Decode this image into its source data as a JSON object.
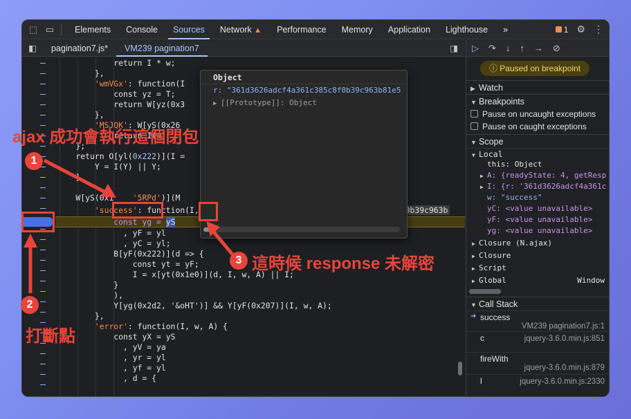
{
  "devtools": {
    "tabs": [
      "Elements",
      "Console",
      "Sources",
      "Network",
      "Performance",
      "Memory",
      "Application",
      "Lighthouse"
    ],
    "active_tab": "Sources",
    "more": "»",
    "issues_count": "1",
    "file_tabs": [
      "pagination7.js*",
      "VM239 pagination7"
    ]
  },
  "popover": {
    "title": "Object",
    "row1_key": "r: ",
    "row1_val": "\"361d3626adcf4a361c385c8f0b39c963b81e5",
    "row2": "[[Prototype]]: Object"
  },
  "code": {
    "l1": "            return I * w;",
    "l2": "        },",
    "l3_key": "'wmVGx'",
    "l3_rest": ": function(I",
    "l4a": "            const yz = T;",
    "l5a": "            return W[yz(0x3",
    "l6": "        },",
    "l7_key": "'MSJQK'",
    "l7_rest": ": W[yS(0x26",
    "l8": "            return I(w)",
    "l9": "    };",
    "l10a": "    return O[yl(",
    "l10b": "0x222",
    "l10c": ")](I = ",
    "l11": "        Y = I(Y) || Y;",
    "l12": "    }",
    "l13a": "    W[yS(0x1",
    "l13b": "'5RPd'",
    "l13c": ")](M",
    "l14_key": "'success'",
    "l14_rest": ": function(I, w, A) {",
    "l14_hint": "I = {r: '361d3626adcf4a361c385c8f0b39c963b",
    "l15a": "            const yg = ",
    "l15b": "yS",
    "l16": "              , yF = yl",
    "l17": "              , yC = yl;",
    "l18": "            B[yF(0x222)](d => {",
    "l19": "                const yt = yF;",
    "l20": "                I = x[yt(0x1e0)](d, I, w, A) || I;",
    "l21": "            }",
    "l22": "            ),",
    "l23": "            Y[yg(0x2d2, '&oHT')] && Y[yF(0x207)](I, w, A);",
    "l24": "        },",
    "l25_key": "'error'",
    "l25_rest": ": function(I, w, A) {",
    "l26": "            const yX = yS",
    "l27": "              , yV = ya",
    "l28": "              , yr = yl",
    "l29": "              , yf = yl",
    "l30": "              , d = {"
  },
  "right_panel": {
    "paused": "Paused on breakpoint",
    "watch": "Watch",
    "breakpoints": "Breakpoints",
    "pause_uncaught": "Pause on uncaught exceptions",
    "pause_caught": "Pause on caught exceptions",
    "scope": "Scope",
    "local": "Local",
    "this_row": "this: Object",
    "A_row": "A: {readyState: 4, getResp",
    "I_row": "I: {r: '361d3626adcf4a361c",
    "w_row": "w: \"success\"",
    "yC_row": "yC: <value unavailable>",
    "yF_row": "yF: <value unavailable>",
    "yg_row": "yg: <value unavailable>",
    "closure1": "Closure (N.ajax)",
    "closure2": "Closure",
    "script": "Script",
    "global": "Global",
    "global_val": "Window",
    "call_stack": "Call Stack",
    "frames": [
      {
        "fn": "success",
        "loc": "VM239 pagination7.js:1"
      },
      {
        "fn": "c",
        "loc": "jquery-3.6.0.min.js:851"
      },
      {
        "fn": "fireWith",
        "loc": "jquery-3.6.0.min.js:879"
      },
      {
        "fn": "l",
        "loc": "jquery-3.6.0.min.js:2330"
      }
    ]
  },
  "annotations": {
    "caption": "ajax 成功會執行這個閉包",
    "step1": "1",
    "step2": "2",
    "step2_label": "打斷點",
    "step3": "3",
    "step3_label": "這時候 response 未解密"
  },
  "colors": {
    "annotation_red": "#e8443a",
    "accent_blue": "#a8c7fa",
    "breakpoint_blue": "#4a6fe3",
    "paused_yellow": "#f2d86b"
  }
}
